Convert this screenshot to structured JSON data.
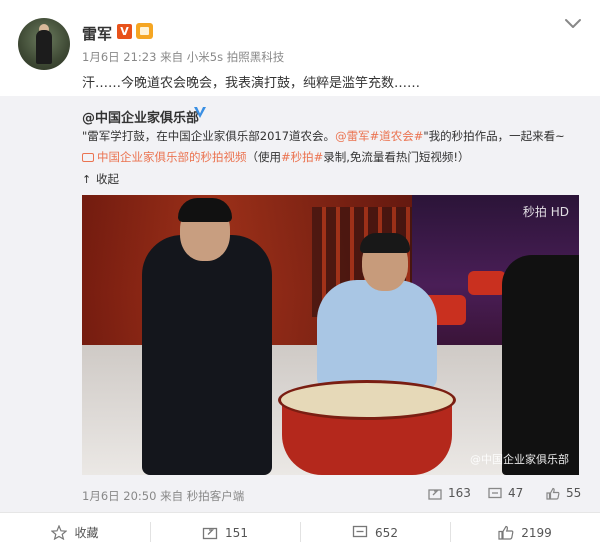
{
  "post": {
    "username": "雷军",
    "vip_badge": "V",
    "meta": {
      "time": "1月6日 21:23",
      "from_prefix": "来自",
      "source": "小米5s 拍照黑科技"
    },
    "text": "汗……今晚道农会晚会，我表演打鼓，纯粹是滥竽充数……"
  },
  "repost": {
    "author": "@中国企业家俱乐部",
    "text_prefix": "\"雷军学打鼓，在中国企业家俱乐部2017道农会。",
    "mention": "@雷军",
    "hashtag": "#道农会#",
    "text_suffix": "\"我的秒拍作品，一起来看~",
    "video_link": "中国企业家俱乐部的秒拍视频",
    "video_note_prefix": "（使用",
    "video_hashtag": "#秒拍#",
    "video_note_suffix": "录制,免流量看热门短视频!）",
    "collapse": "收起",
    "photo": {
      "watermark_top": "秒拍 HD",
      "watermark_bottom": "@中国企业家俱乐部"
    },
    "footer": {
      "time": "1月6日 20:50",
      "from_prefix": "来自",
      "source": "秒拍客户端",
      "reposts": "163",
      "comments": "47",
      "likes": "55"
    }
  },
  "actions": {
    "favorite": "收藏",
    "repost": "151",
    "comment": "652",
    "like": "2199"
  },
  "colors": {
    "link": "#eb7350",
    "meta": "#888888",
    "repost_bg": "#f2f2f5",
    "vip": "#e8521b"
  },
  "icons": {
    "vip_badge": "vip-v-icon",
    "fan_badge": "crown-icon",
    "menu": "chevron-down-icon",
    "verified": "blue-v-icon",
    "video": "video-icon",
    "collapse": "arrow-up-icon",
    "repost": "repost-icon",
    "comment": "comment-icon",
    "like": "thumb-up-icon",
    "favorite": "star-icon"
  }
}
